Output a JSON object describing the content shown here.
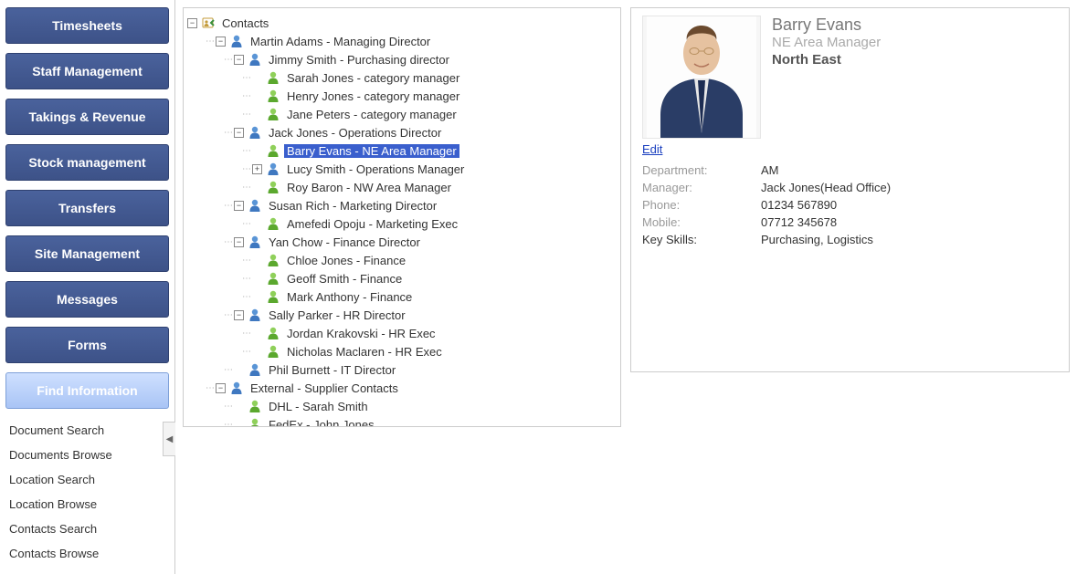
{
  "sidebar": {
    "buttons": [
      {
        "label": "Timesheets"
      },
      {
        "label": "Staff Management"
      },
      {
        "label": "Takings & Revenue"
      },
      {
        "label": "Stock management"
      },
      {
        "label": "Transfers"
      },
      {
        "label": "Site Management"
      },
      {
        "label": "Messages"
      },
      {
        "label": "Forms"
      },
      {
        "label": "Find Information",
        "active": true
      }
    ],
    "subitems": [
      "Document Search",
      "Documents Browse",
      "Location Search",
      "Location Browse",
      "Contacts Search",
      "Contacts Browse"
    ]
  },
  "tree": {
    "root": {
      "label": "Contacts",
      "icon": "contacts",
      "expander": "minus"
    },
    "nodes": [
      {
        "indent": 1,
        "expander": "minus",
        "icon": "blue",
        "label": "Martin Adams - Managing Director"
      },
      {
        "indent": 2,
        "expander": "minus",
        "icon": "blue",
        "label": "Jimmy Smith - Purchasing director"
      },
      {
        "indent": 3,
        "expander": "none",
        "icon": "green",
        "label": "Sarah Jones - category manager"
      },
      {
        "indent": 3,
        "expander": "none",
        "icon": "green",
        "label": "Henry Jones - category manager"
      },
      {
        "indent": 3,
        "expander": "none",
        "icon": "green",
        "label": "Jane Peters - category manager"
      },
      {
        "indent": 2,
        "expander": "minus",
        "icon": "blue",
        "label": "Jack Jones - Operations Director"
      },
      {
        "indent": 3,
        "expander": "none",
        "icon": "green",
        "label": "Barry Evans - NE Area Manager",
        "selected": true
      },
      {
        "indent": 3,
        "expander": "plus",
        "icon": "blue",
        "label": "Lucy Smith - Operations Manager"
      },
      {
        "indent": 3,
        "expander": "none",
        "icon": "green",
        "label": "Roy Baron - NW Area Manager"
      },
      {
        "indent": 2,
        "expander": "minus",
        "icon": "blue",
        "label": "Susan Rich - Marketing Director"
      },
      {
        "indent": 3,
        "expander": "none",
        "icon": "green",
        "label": "Amefedi Opoju - Marketing Exec"
      },
      {
        "indent": 2,
        "expander": "minus",
        "icon": "blue",
        "label": "Yan Chow - Finance Director"
      },
      {
        "indent": 3,
        "expander": "none",
        "icon": "green",
        "label": "Chloe Jones - Finance"
      },
      {
        "indent": 3,
        "expander": "none",
        "icon": "green",
        "label": "Geoff Smith - Finance"
      },
      {
        "indent": 3,
        "expander": "none",
        "icon": "green",
        "label": "Mark Anthony - Finance"
      },
      {
        "indent": 2,
        "expander": "minus",
        "icon": "blue",
        "label": "Sally Parker - HR Director"
      },
      {
        "indent": 3,
        "expander": "none",
        "icon": "green",
        "label": "Jordan Krakovski - HR Exec"
      },
      {
        "indent": 3,
        "expander": "none",
        "icon": "green",
        "label": "Nicholas Maclaren - HR Exec"
      },
      {
        "indent": 2,
        "expander": "none",
        "icon": "blue",
        "label": "Phil Burnett - IT Director"
      },
      {
        "indent": 1,
        "expander": "minus",
        "icon": "blue",
        "label": "External - Supplier Contacts"
      },
      {
        "indent": 2,
        "expander": "none",
        "icon": "green",
        "label": "DHL - Sarah Smith"
      },
      {
        "indent": 2,
        "expander": "none",
        "icon": "green",
        "label": "FedEx - John Jones"
      }
    ]
  },
  "detail": {
    "name": "Barry Evans",
    "title": "NE Area Manager",
    "region": "North East",
    "edit": "Edit",
    "rows": [
      {
        "label": "Department:",
        "value": "AM",
        "muted": true
      },
      {
        "label": "Manager:",
        "value": "Jack Jones(Head Office)",
        "muted": true
      },
      {
        "label": "Phone:",
        "value": "01234 567890",
        "muted": true
      },
      {
        "label": "Mobile:",
        "value": "07712 345678",
        "muted": true
      },
      {
        "label": "Key Skills:",
        "value": "Purchasing, Logistics",
        "muted": false
      }
    ]
  }
}
